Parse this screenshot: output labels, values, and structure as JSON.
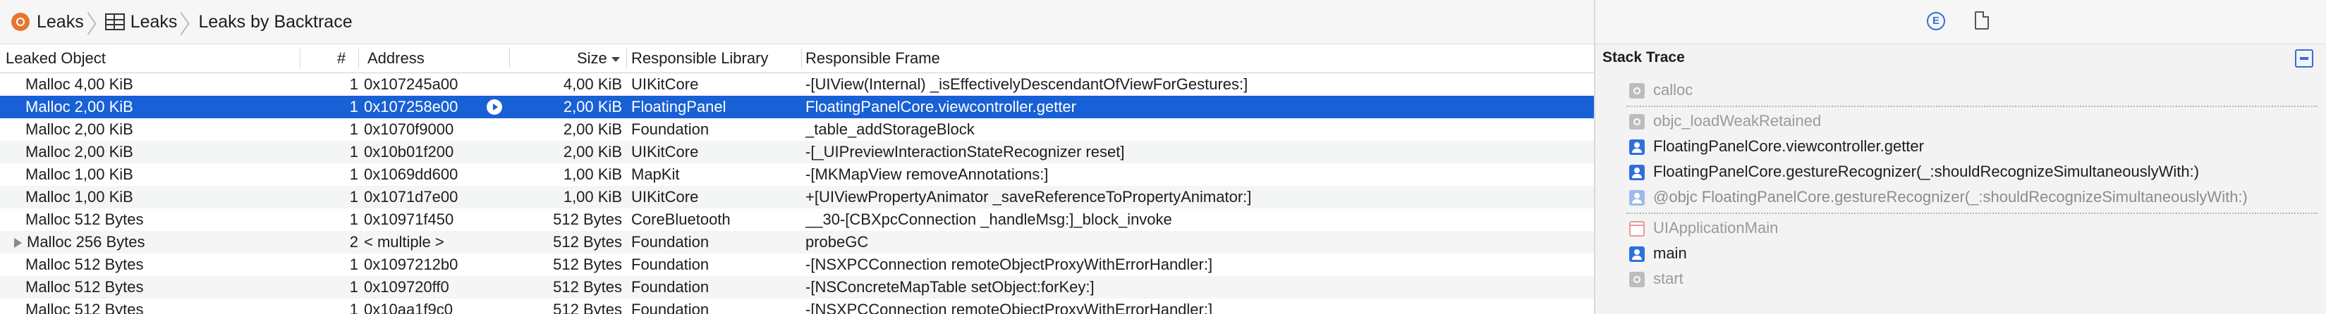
{
  "breadcrumb": {
    "items": [
      "Leaks",
      "Leaks",
      "Leaks by Backtrace"
    ]
  },
  "table": {
    "columns": {
      "object": "Leaked Object",
      "count": "#",
      "address": "Address",
      "size": "Size",
      "library": "Responsible Library",
      "frame": "Responsible Frame"
    },
    "rows": [
      {
        "object": "Malloc 4,00 KiB",
        "count": "1",
        "address": "0x107245a00",
        "size": "4,00 KiB",
        "library": "UIKitCore",
        "frame": "-[UIView(Internal) _isEffectivelyDescendantOfViewForGestures:]"
      },
      {
        "object": "Malloc 2,00 KiB",
        "count": "1",
        "address": "0x107258e00",
        "size": "2,00 KiB",
        "library": "FloatingPanel",
        "frame": "FloatingPanelCore.viewcontroller.getter"
      },
      {
        "object": "Malloc 2,00 KiB",
        "count": "1",
        "address": "0x1070f9000",
        "size": "2,00 KiB",
        "library": "Foundation",
        "frame": "_table_addStorageBlock"
      },
      {
        "object": "Malloc 2,00 KiB",
        "count": "1",
        "address": "0x10b01f200",
        "size": "2,00 KiB",
        "library": "UIKitCore",
        "frame": "-[_UIPreviewInteractionStateRecognizer reset]"
      },
      {
        "object": "Malloc 1,00 KiB",
        "count": "1",
        "address": "0x1069dd600",
        "size": "1,00 KiB",
        "library": "MapKit",
        "frame": "-[MKMapView removeAnnotations:]"
      },
      {
        "object": "Malloc 1,00 KiB",
        "count": "1",
        "address": "0x1071d7e00",
        "size": "1,00 KiB",
        "library": "UIKitCore",
        "frame": "+[UIViewPropertyAnimator _saveReferenceToPropertyAnimator:]"
      },
      {
        "object": "Malloc 512 Bytes",
        "count": "1",
        "address": "0x10971f450",
        "size": "512 Bytes",
        "library": "CoreBluetooth",
        "frame": "__30-[CBXpcConnection _handleMsg:]_block_invoke"
      },
      {
        "object": "Malloc 256 Bytes",
        "count": "2",
        "address": "< multiple >",
        "size": "512 Bytes",
        "library": "Foundation",
        "frame": "probeGC"
      },
      {
        "object": "Malloc 512 Bytes",
        "count": "1",
        "address": "0x1097212b0",
        "size": "512 Bytes",
        "library": "Foundation",
        "frame": "-[NSXPCConnection remoteObjectProxyWithErrorHandler:]"
      },
      {
        "object": "Malloc 512 Bytes",
        "count": "1",
        "address": "0x109720ff0",
        "size": "512 Bytes",
        "library": "Foundation",
        "frame": "-[NSConcreteMapTable setObject:forKey:]"
      },
      {
        "object": "Malloc 512 Bytes",
        "count": "1",
        "address": "0x10aa1f9c0",
        "size": "512 Bytes",
        "library": "Foundation",
        "frame": "-[NSXPCConnection remoteObjectProxyWithErrorHandler:]"
      }
    ]
  },
  "stack_trace": {
    "title": "Stack Trace",
    "frames": [
      "calloc",
      "objc_loadWeakRetained",
      "FloatingPanelCore.viewcontroller.getter",
      "FloatingPanelCore.gestureRecognizer(_:shouldRecognizeSimultaneouslyWith:)",
      "@objc FloatingPanelCore.gestureRecognizer(_:shouldRecognizeSimultaneouslyWith:)",
      "UIApplicationMain",
      "main",
      "start"
    ]
  },
  "icons": {
    "breadcrumb_root": "leaks-instrument-icon",
    "breadcrumb_view": "table-grid-icon",
    "inspector_extended": "extended-detail-icon",
    "inspector_document": "document-icon",
    "stack_toggle": "stack-options-icon"
  },
  "colors": {
    "selection": "#1860d6",
    "accent": "#2f6fde",
    "leaks_orange": "#e8762d"
  }
}
